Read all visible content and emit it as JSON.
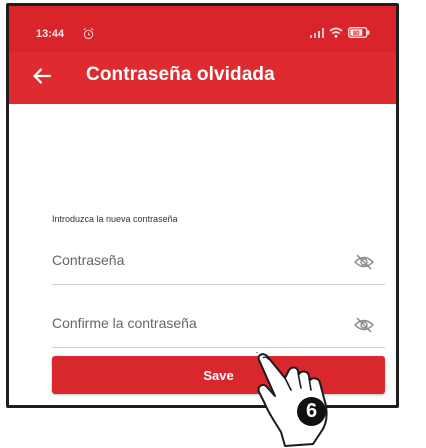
{
  "status_bar": {
    "time": "13:44",
    "battery": "80"
  },
  "app_bar": {
    "title": "Contraseña olvidada"
  },
  "form": {
    "prompt": "Introduzca la nueva contraseña",
    "password_label": "Contraseña",
    "confirm_label": "Confirme la contraseña",
    "save_label": "Save"
  },
  "annotation": {
    "step_number": "6"
  },
  "colors": {
    "primary": "#df2b2f",
    "button": "#d8272d"
  },
  "icons": {
    "back": "arrow-left-icon",
    "alarm": "alarm-icon",
    "visibility": "eye-off-icon",
    "pointer": "hand-pointer-icon"
  }
}
